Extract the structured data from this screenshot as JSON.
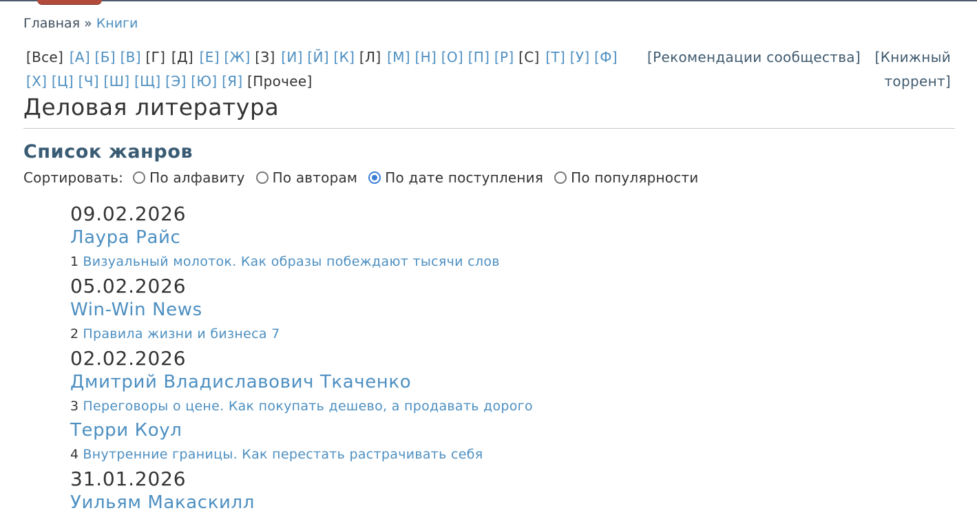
{
  "breadcrumb": {
    "home": "Главная",
    "sep": "»",
    "current": "Книги"
  },
  "alphabet": [
    {
      "label": "[Все]",
      "active": false
    },
    {
      "label": "[А]",
      "active": true
    },
    {
      "label": "[Б]",
      "active": true
    },
    {
      "label": "[В]",
      "active": true
    },
    {
      "label": "[Г]",
      "active": false
    },
    {
      "label": "[Д]",
      "active": false
    },
    {
      "label": "[Е]",
      "active": true
    },
    {
      "label": "[Ж]",
      "active": true
    },
    {
      "label": "[З]",
      "active": false
    },
    {
      "label": "[И]",
      "active": true
    },
    {
      "label": "[Й]",
      "active": true
    },
    {
      "label": "[К]",
      "active": true
    },
    {
      "label": "[Л]",
      "active": false
    },
    {
      "label": "[М]",
      "active": true
    },
    {
      "label": "[Н]",
      "active": true
    },
    {
      "label": "[О]",
      "active": true
    },
    {
      "label": "[П]",
      "active": true
    },
    {
      "label": "[Р]",
      "active": true
    },
    {
      "label": "[С]",
      "active": false
    },
    {
      "label": "[Т]",
      "active": true
    },
    {
      "label": "[У]",
      "active": true
    },
    {
      "label": "[Ф]",
      "active": true
    },
    {
      "label": "[Х]",
      "active": true
    },
    {
      "label": "[Ц]",
      "active": true
    },
    {
      "label": "[Ч]",
      "active": true
    },
    {
      "label": "[Ш]",
      "active": true
    },
    {
      "label": "[Щ]",
      "active": true
    },
    {
      "label": "[Э]",
      "active": true
    },
    {
      "label": "[Ю]",
      "active": true
    },
    {
      "label": "[Я]",
      "active": true
    },
    {
      "label": "[Прочее]",
      "active": false
    }
  ],
  "links": {
    "recommendations": "[Рекомендации сообщества]",
    "torrent_line1": "[Книжный",
    "torrent_line2": "торрент]"
  },
  "page_title": "Деловая литература",
  "section_title": "Список жанров",
  "sort": {
    "label": "Сортировать:",
    "options": [
      {
        "label": "По алфавиту",
        "checked": false
      },
      {
        "label": "По авторам",
        "checked": false
      },
      {
        "label": "По дате поступления",
        "checked": true
      },
      {
        "label": "По популярности",
        "checked": false
      }
    ]
  },
  "entries": [
    {
      "date": "09.02.2026",
      "authors": [
        {
          "name": "Лаура Райс",
          "books": [
            {
              "num": "1",
              "title": "Визуальный молоток. Как образы побеждают тысячи слов"
            }
          ]
        }
      ]
    },
    {
      "date": "05.02.2026",
      "authors": [
        {
          "name": "Win-Win News",
          "books": [
            {
              "num": "2",
              "title": "Правила жизни и бизнеса 7"
            }
          ]
        }
      ]
    },
    {
      "date": "02.02.2026",
      "authors": [
        {
          "name": "Дмитрий Владиславович Ткаченко",
          "books": [
            {
              "num": "3",
              "title": "Переговоры о цене. Как покупать дешево, а продавать дорого"
            }
          ]
        },
        {
          "name": "Терри Коул",
          "books": [
            {
              "num": "4",
              "title": "Внутренние границы. Как перестать растрачивать себя"
            }
          ]
        }
      ]
    },
    {
      "date": "31.01.2026",
      "authors": [
        {
          "name": "Уильям Макаскилл",
          "books": []
        }
      ]
    }
  ]
}
